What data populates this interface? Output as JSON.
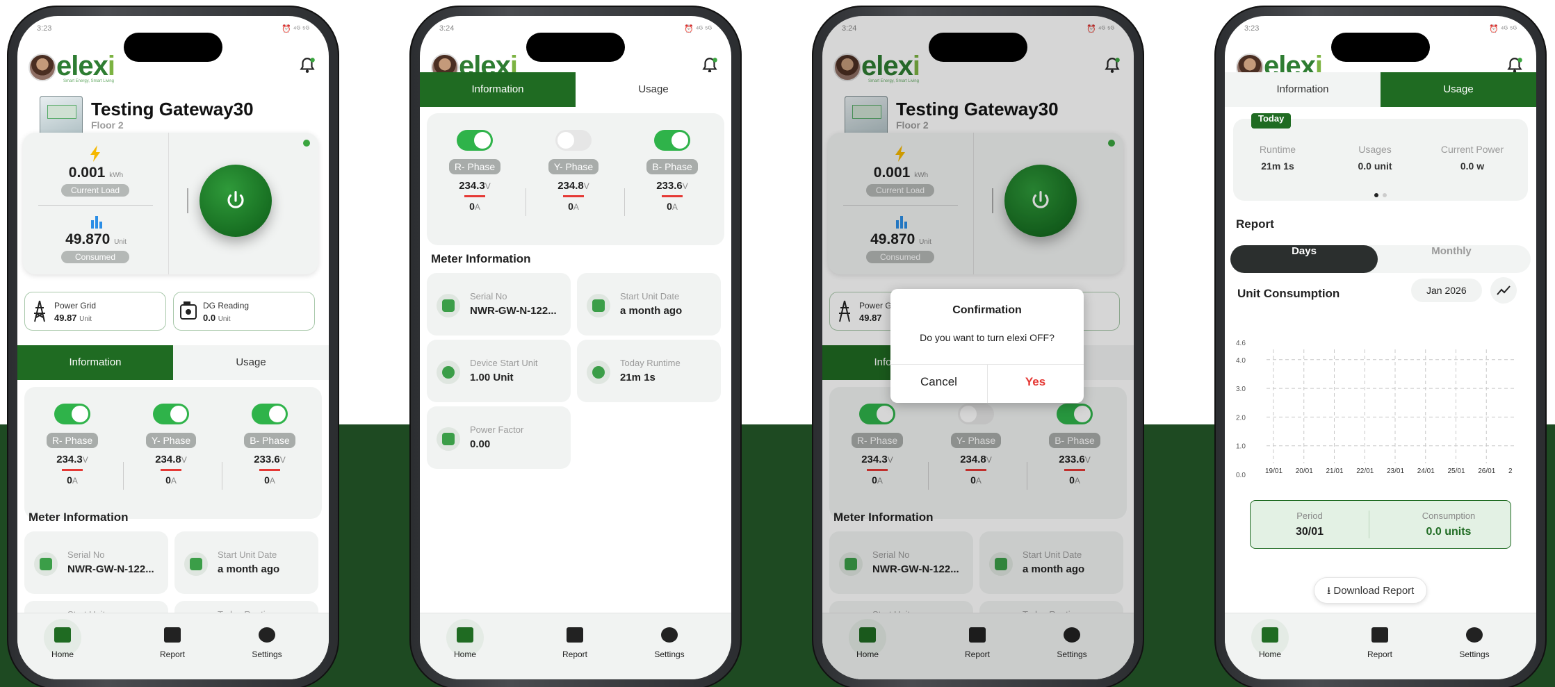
{
  "brand": {
    "logo_main": "elex",
    "logo_i": "i",
    "tagline": "Smart Energy, Smart Living",
    "green": "#1f6b22",
    "accent": "#2fb34a"
  },
  "status": {
    "time1": "3:23",
    "time2": "3:24",
    "time3": "3:24",
    "time4": "3:23",
    "icons": "⏰ ⁴ᴳ ⁵ᴳ"
  },
  "device": {
    "name": "Testing Gateway30",
    "floor": "Floor 2"
  },
  "load": {
    "current": "0.001",
    "current_unit": "kWh",
    "current_label": "Current Load",
    "consumed": "49.870",
    "consumed_unit": "Unit",
    "consumed_label": "Consumed"
  },
  "sources": {
    "power_grid_label": "Power Grid",
    "power_grid_value": "49.87",
    "power_grid_unit": "Unit",
    "dg_label": "DG Reading",
    "dg_value": "0.0",
    "dg_unit": "Unit"
  },
  "tabs": {
    "information": "Information",
    "usage": "Usage"
  },
  "phases": [
    {
      "label": "R- Phase",
      "voltage": "234.3",
      "current": "0",
      "on": true
    },
    {
      "label": "Y- Phase",
      "voltage": "234.8",
      "current": "0",
      "on": true
    },
    {
      "label": "B- Phase",
      "voltage": "233.6",
      "current": "0",
      "on": true
    }
  ],
  "phases_p2": [
    {
      "label": "R- Phase",
      "voltage": "234.3",
      "current": "0",
      "on": true
    },
    {
      "label": "Y- Phase",
      "voltage": "234.8",
      "current": "0",
      "on": false
    },
    {
      "label": "B- Phase",
      "voltage": "233.6",
      "current": "0",
      "on": true
    }
  ],
  "units": {
    "volt": "V",
    "amp": "A"
  },
  "meter_info": {
    "title": "Meter Information",
    "serial_label": "Serial No",
    "serial_value": "NWR-GW-N-122...",
    "start_date_label": "Start Unit Date",
    "start_date_value": "a month ago",
    "device_start_label": "Device Start Unit",
    "device_start_value": "1.00 Unit",
    "runtime_label": "Today Runtime",
    "runtime_value": "21m 1s",
    "pf_label": "Power Factor",
    "pf_value": "0.00",
    "cut_start_label": "Start Unit",
    "cut_runtime_label": "Today Runtime"
  },
  "nav": {
    "home": "Home",
    "report": "Report",
    "settings": "Settings"
  },
  "dialog": {
    "title": "Confirmation",
    "message": "Do you want to turn elexi OFF?",
    "cancel": "Cancel",
    "yes": "Yes",
    "yes_color": "#e53935"
  },
  "usage": {
    "today_tag": "Today",
    "runtime_label": "Runtime",
    "runtime_value": "21m 1s",
    "usages_label": "Usages",
    "usages_value": "0.0 unit",
    "power_label": "Current Power",
    "power_value": "0.0 w"
  },
  "report": {
    "title": "Report",
    "days": "Days",
    "monthly": "Monthly",
    "chart_title": "Unit Consumption",
    "month_chip": "Jan 2026",
    "period_label": "Period",
    "period_value": "30/01",
    "consumption_label": "Consumption",
    "consumption_value": "0.0 units",
    "download": "Download Report"
  },
  "chart_data": {
    "type": "line",
    "title": "Unit Consumption",
    "categories": [
      "19/01",
      "20/01",
      "21/01",
      "22/01",
      "23/01",
      "24/01",
      "25/01",
      "26/01",
      "2"
    ],
    "values": [
      0,
      0,
      0,
      0,
      0,
      0,
      0,
      0,
      0
    ],
    "y_ticks": [
      "0.0",
      "1.0",
      "2.0",
      "3.0",
      "4.0",
      "4.6"
    ],
    "ylim": [
      0,
      4.6
    ],
    "grid": true
  }
}
